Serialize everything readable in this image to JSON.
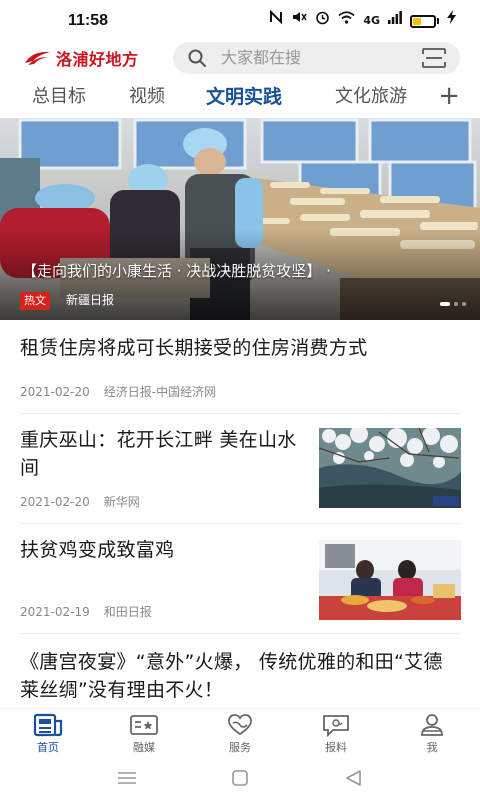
{
  "status_bar": {
    "time": "11:58",
    "network": "4G",
    "icons": [
      "nfc-icon",
      "mute-icon",
      "alarm-icon",
      "wifi-icon",
      "signal-icon",
      "battery-icon",
      "charging-icon"
    ]
  },
  "header": {
    "logo_text": "洛浦好地方",
    "search_placeholder": "大家都在搜",
    "brand_color": "#c9161d"
  },
  "tabs": {
    "items": [
      "总目标",
      "视频",
      "文明实践",
      "文化旅游"
    ],
    "active_index": 2,
    "active_color": "#1a4f9c"
  },
  "banner": {
    "caption": "【走向我们的小康生活 · 决战决胜脱贫攻坚】 · ",
    "tag": "热文",
    "source": "新疆日报"
  },
  "news": [
    {
      "title": "租赁住房将成可长期接受的住房消费方式",
      "date": "2021-02-20",
      "source": "经济日报-中国经济网"
    },
    {
      "title": "重庆巫山：花开长江畔 美在山水间",
      "date": "2021-02-20",
      "source": "新华网"
    },
    {
      "title": "扶贫鸡变成致富鸡",
      "date": "2021-02-19",
      "source": "和田日报"
    },
    {
      "title": "《唐宫夜宴》“意外”火爆， 传统优雅的和田“艾德莱丝绸”没有理由不火！"
    }
  ],
  "bottom_nav": {
    "items": [
      {
        "label": "首页",
        "icon": "home-news-icon"
      },
      {
        "label": "融媒",
        "icon": "media-icon"
      },
      {
        "label": "服务",
        "icon": "service-heart-icon"
      },
      {
        "label": "报料",
        "icon": "report-chat-icon"
      },
      {
        "label": "我",
        "icon": "user-icon"
      }
    ],
    "active_index": 0
  }
}
